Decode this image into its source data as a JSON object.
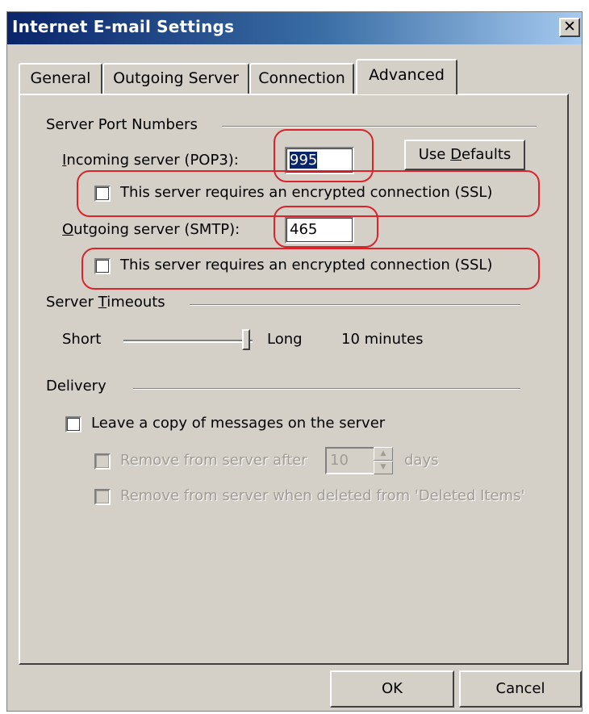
{
  "window": {
    "title": "Internet E-mail Settings",
    "close_glyph": "✕"
  },
  "tabs": [
    {
      "label": "General"
    },
    {
      "label": "Outgoing Server"
    },
    {
      "label": "Connection"
    },
    {
      "label": "Advanced",
      "active": true
    }
  ],
  "ports": {
    "group_label": "Server Port Numbers",
    "incoming_label": "Incoming server (POP3):",
    "incoming_value": "995",
    "incoming_ssl_label": "This server requires an encrypted connection (SSL)",
    "incoming_ssl_checked": false,
    "outgoing_label": "Outgoing server (SMTP):",
    "outgoing_value": "465",
    "outgoing_ssl_label": "This server requires an encrypted connection (SSL)",
    "outgoing_ssl_checked": false,
    "use_defaults_label": "Use Defaults"
  },
  "timeouts": {
    "group_label": "Server Timeouts",
    "short_label": "Short",
    "long_label": "Long",
    "value_text": "10 minutes",
    "slider_level": 0.95
  },
  "delivery": {
    "group_label": "Delivery",
    "leave_copy_label": "Leave a copy of messages on the server",
    "leave_copy_checked": false,
    "remove_after_label": "Remove from server after",
    "remove_after_days": "10",
    "days_label": "days",
    "remove_deleted_label": "Remove from server when deleted from 'Deleted Items'"
  },
  "footer": {
    "ok_label": "OK",
    "cancel_label": "Cancel"
  },
  "colors": {
    "annotation": "#d9242b",
    "titlebar_start": "#0a246a",
    "dialog_bg": "#d4d0c8"
  }
}
